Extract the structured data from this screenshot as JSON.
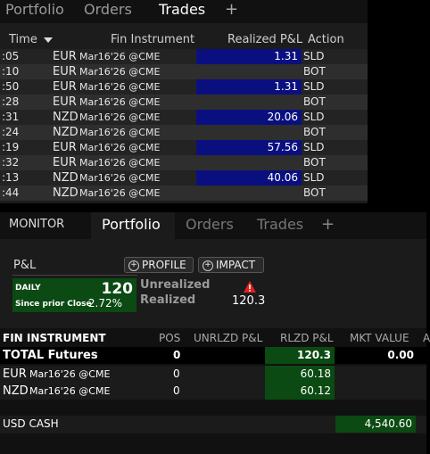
{
  "top_tabs": [
    "Portfolio",
    "Orders",
    "Trades"
  ],
  "plus_glyph": "+",
  "trades_headers": {
    "time": "Time",
    "instrument": "Fin Instrument",
    "pnl": "Realized P&L",
    "action": "Action"
  },
  "trades": [
    {
      "time": ":05",
      "currency": "EUR",
      "expiry": "Mar16'26 @CME",
      "pnl": "1.31",
      "action": "SLD"
    },
    {
      "time": ":10",
      "currency": "EUR",
      "expiry": "Mar16'26 @CME",
      "pnl": "",
      "action": "BOT"
    },
    {
      "time": ":50",
      "currency": "EUR",
      "expiry": "Mar16'26 @CME",
      "pnl": "1.31",
      "action": "SLD"
    },
    {
      "time": ":28",
      "currency": "EUR",
      "expiry": "Mar16'26 @CME",
      "pnl": "",
      "action": "BOT"
    },
    {
      "time": ":31",
      "currency": "NZD",
      "expiry": "Mar16'26 @CME",
      "pnl": "20.06",
      "action": "SLD"
    },
    {
      "time": ":24",
      "currency": "NZD",
      "expiry": "Mar16'26 @CME",
      "pnl": "",
      "action": "BOT"
    },
    {
      "time": ":19",
      "currency": "EUR",
      "expiry": "Mar16'26 @CME",
      "pnl": "57.56",
      "action": "SLD"
    },
    {
      "time": ":32",
      "currency": "EUR",
      "expiry": "Mar16'26 @CME",
      "pnl": "",
      "action": "BOT"
    },
    {
      "time": ":13",
      "currency": "NZD",
      "expiry": "Mar16'26 @CME",
      "pnl": "40.06",
      "action": "SLD"
    },
    {
      "time": ":44",
      "currency": "NZD",
      "expiry": "Mar16'26 @CME",
      "pnl": "",
      "action": "BOT"
    }
  ],
  "bottom_tabs": {
    "monitor": "MONITOR",
    "portfolio": "Portfolio",
    "orders": "Orders",
    "trades": "Trades"
  },
  "summary": {
    "pnl_label": "P&L",
    "profile_btn": "PROFILE",
    "impact_btn": "IMPACT",
    "daily_label": "DAILY",
    "daily_value": "120",
    "since_prior_label": "Since prior Close",
    "since_prior_value": "2.72%",
    "unrealized_label": "Unrealized",
    "realized_label": "Realized",
    "realized_value": "120.3"
  },
  "portfolio_headers": {
    "instrument": "FIN INSTRUMENT",
    "pos": "POS",
    "unrlzd": "UNRLZD P&L",
    "rlzd": "RLZD P&L",
    "mkt": "MKT VALUE",
    "extra": "A"
  },
  "portfolio_total": {
    "label": "TOTAL Futures",
    "pos": "0",
    "rlzd": "120.3",
    "mkt": "0.00"
  },
  "portfolio_rows": [
    {
      "currency": "EUR",
      "expiry": "Mar16'26 @CME",
      "pos": "0",
      "rlzd": "60.18"
    },
    {
      "currency": "NZD",
      "expiry": "Mar16'26 @CME",
      "pos": "0",
      "rlzd": "60.12"
    }
  ],
  "cash": {
    "label": "USD CASH",
    "value": "4,540.60"
  },
  "colors": {
    "pnl_fill": "#0a0f80",
    "green_fill": "#0b4a12",
    "alert": "#e02020"
  }
}
